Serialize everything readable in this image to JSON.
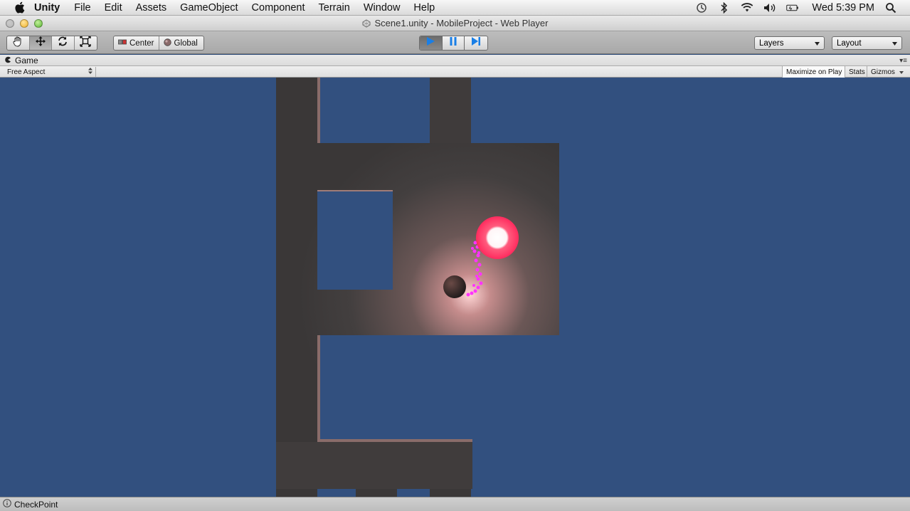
{
  "menubar": {
    "app_name": "Unity",
    "items": [
      "File",
      "Edit",
      "Assets",
      "GameObject",
      "Component",
      "Terrain",
      "Window",
      "Help"
    ],
    "clock": "Wed 5:39 PM"
  },
  "window": {
    "title": "Scene1.unity - MobileProject - Web Player"
  },
  "toolbar": {
    "tools": [
      "hand-tool",
      "move-tool",
      "rotate-tool",
      "scale-tool"
    ],
    "active_tool": "move-tool",
    "pivot_label": "Center",
    "space_label": "Global",
    "layers_label": "Layers",
    "layout_label": "Layout"
  },
  "game_panel": {
    "tab_label": "Game",
    "aspect_label": "Free Aspect",
    "maximize_label": "Maximize on Play",
    "stats_label": "Stats",
    "gizmos_label": "Gizmos"
  },
  "statusbar": {
    "message": "CheckPoint"
  },
  "colors": {
    "game_background": "#32507f",
    "wall": "#433f3f",
    "checkpoint": "#ff2b5e",
    "trail": "#ff33ff",
    "play_accent": "#1a7fe6"
  }
}
